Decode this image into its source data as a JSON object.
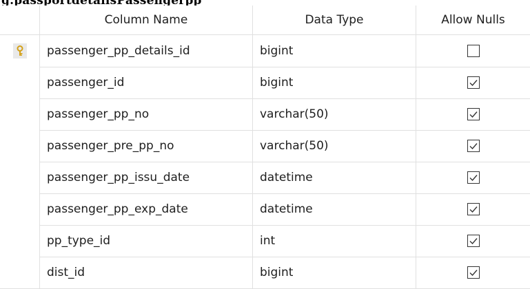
{
  "title_fragment": "g.passportdetailsPassengerpp",
  "columns": {
    "name": "Column Name",
    "type": "Data Type",
    "nulls": "Allow Nulls"
  },
  "rows": [
    {
      "name": "passenger_pp_details_id",
      "type": "bigint",
      "allow_nulls": false,
      "primary_key": true
    },
    {
      "name": "passenger_id",
      "type": "bigint",
      "allow_nulls": true,
      "primary_key": false
    },
    {
      "name": "passenger_pp_no",
      "type": "varchar(50)",
      "allow_nulls": true,
      "primary_key": false
    },
    {
      "name": "passenger_pre_pp_no",
      "type": "varchar(50)",
      "allow_nulls": true,
      "primary_key": false
    },
    {
      "name": "passenger_pp_issu_date",
      "type": "datetime",
      "allow_nulls": true,
      "primary_key": false
    },
    {
      "name": "passenger_pp_exp_date",
      "type": "datetime",
      "allow_nulls": true,
      "primary_key": false
    },
    {
      "name": "pp_type_id",
      "type": "int",
      "allow_nulls": true,
      "primary_key": false
    },
    {
      "name": "dist_id",
      "type": "bigint",
      "allow_nulls": true,
      "primary_key": false
    }
  ],
  "icons": {
    "primary_key": "key-icon",
    "checked": "checkmark-icon"
  },
  "colors": {
    "grid_line": "#e0e0e0",
    "key": "#d4a017"
  }
}
